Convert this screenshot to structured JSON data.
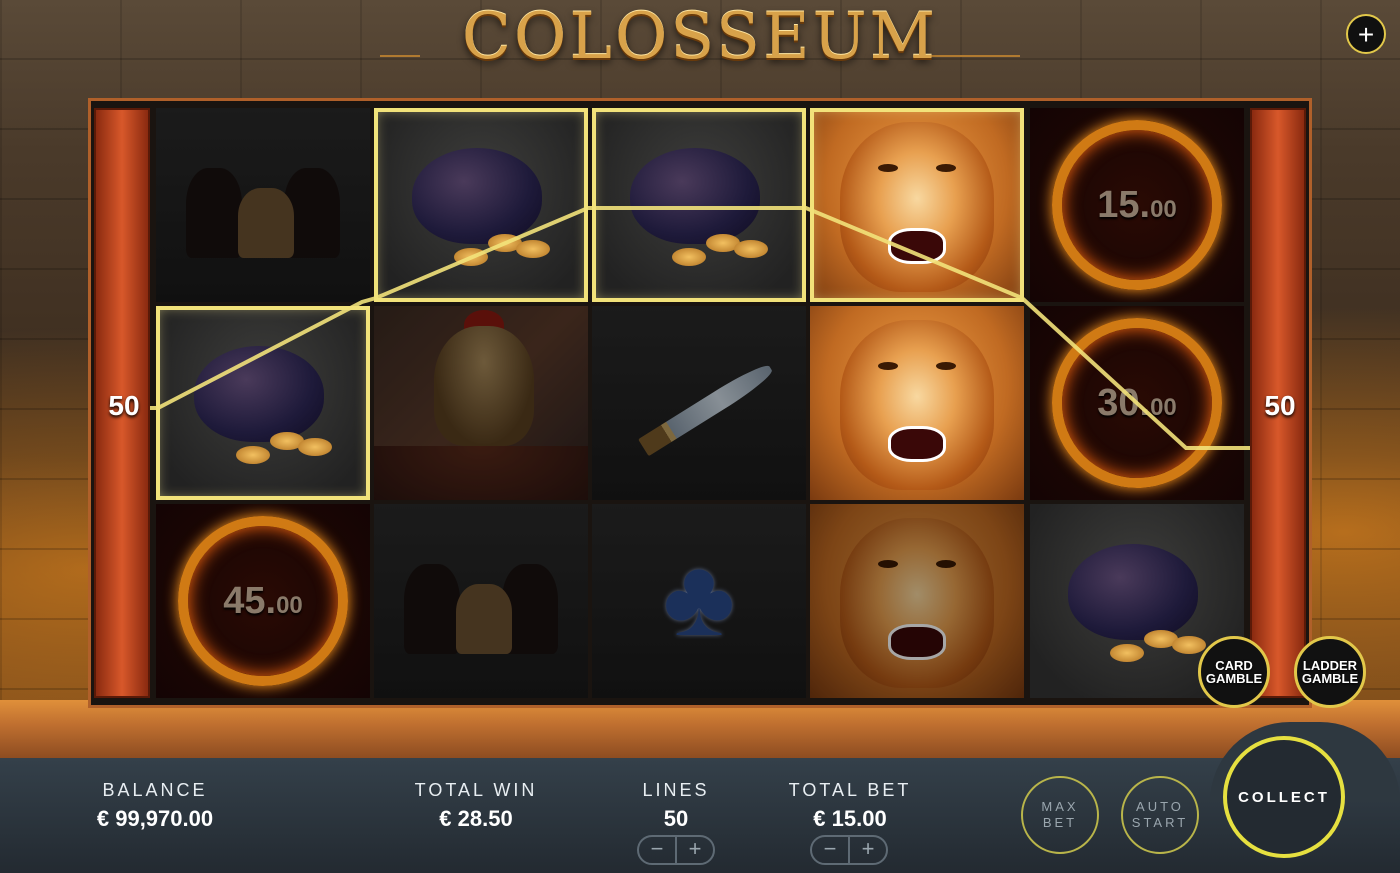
{
  "game": {
    "title": "COLOSSEUM",
    "lines_indicator_left": "50",
    "lines_indicator_right": "50"
  },
  "controls": {
    "plus_button": "+",
    "card_gamble": "CARD GAMBLE",
    "ladder_gamble": "LADDER GAMBLE",
    "max_bet": "MAX BET",
    "auto_start": "AUTO START",
    "collect": "COLLECT"
  },
  "reels": {
    "col1": [
      "chariot",
      "coin-bag",
      "fire-ring"
    ],
    "col2": [
      "coin-bag",
      "gladiator",
      "chariot"
    ],
    "col3": [
      "coin-bag",
      "sword",
      "club"
    ],
    "col4": [
      "lion",
      "lion",
      "lion"
    ],
    "col5": [
      "fire-ring",
      "fire-ring",
      "coin-bag"
    ],
    "fire_values": {
      "r5c1": {
        "main": "15.",
        "cents": "00"
      },
      "r5c2": {
        "main": "30.",
        "cents": "00"
      },
      "r1c3": {
        "main": "45.",
        "cents": "00"
      }
    }
  },
  "status": {
    "balance_label": "BALANCE",
    "balance_value": "€ 99,970.00",
    "total_win_label": "TOTAL WIN",
    "total_win_value": "€ 28.50",
    "lines_label": "LINES",
    "lines_value": "50",
    "total_bet_label": "TOTAL BET",
    "total_bet_value": "€ 15.00",
    "minus": "−",
    "plus": "+"
  },
  "colors": {
    "accent": "#e6e040",
    "win_highlight": "#f2e27a",
    "panel": "#2a333b"
  }
}
